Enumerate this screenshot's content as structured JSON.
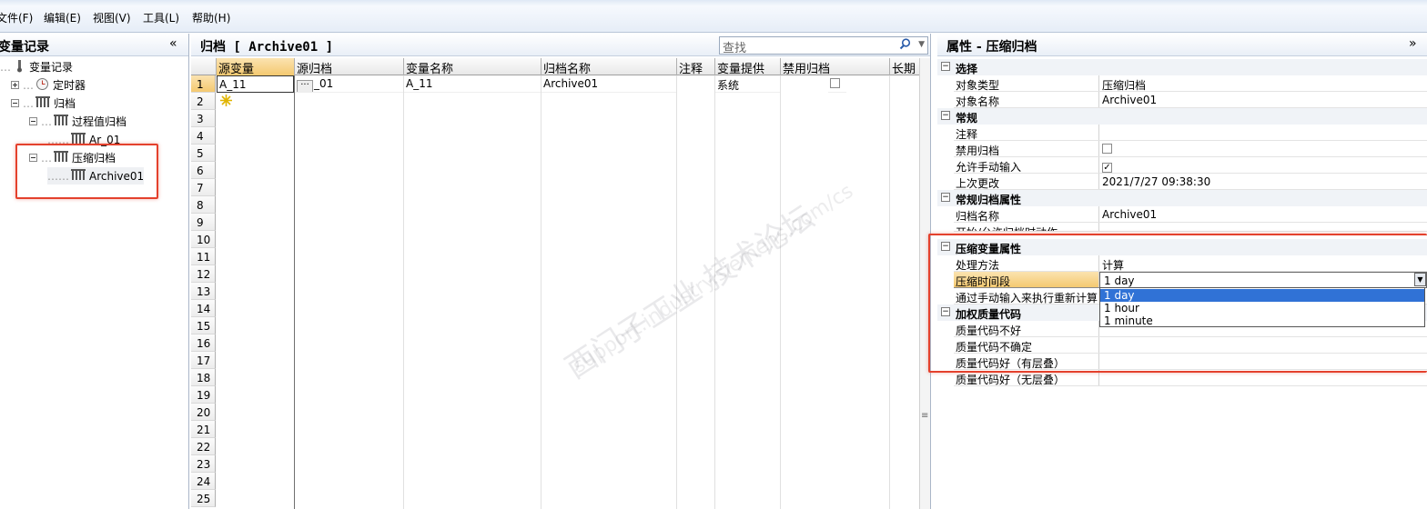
{
  "menu": [
    "文件(F)",
    "编辑(E)",
    "视图(V)",
    "工具(L)",
    "帮助(H)"
  ],
  "left": {
    "title": "变量记录",
    "collapse": "«",
    "tree": [
      {
        "label": "变量记录"
      },
      {
        "label": "定时器"
      },
      {
        "label": "归档"
      },
      {
        "label": "过程值归档"
      },
      {
        "label": "Ar_01"
      },
      {
        "label": "压缩归档"
      },
      {
        "label": "Archive01"
      }
    ]
  },
  "center": {
    "title": "归档 [ Archive01 ]",
    "search_placeholder": "查找",
    "columns": [
      "源变量",
      "源归档",
      "变量名称",
      "归档名称",
      "注释",
      "变量提供",
      "禁用归档",
      "长期"
    ],
    "row1": {
      "num": "1",
      "src_var": "A_11",
      "src_archive": "_01",
      "var_name": "A_11",
      "archive_name": "Archive01",
      "provider": "系统"
    },
    "row_numbers": [
      "2",
      "3",
      "4",
      "5",
      "6",
      "7",
      "8",
      "9",
      "10",
      "11",
      "12",
      "13",
      "14",
      "15",
      "16",
      "17",
      "18",
      "19",
      "20",
      "21",
      "22",
      "23",
      "24",
      "25"
    ]
  },
  "right": {
    "title": "属性 - 压缩归档",
    "expand": "»",
    "sec_select": "选择",
    "obj_type_k": "对象类型",
    "obj_type_v": "压缩归档",
    "obj_name_k": "对象名称",
    "obj_name_v": "Archive01",
    "sec_general": "常规",
    "comment_k": "注释",
    "disable_k": "禁用归档",
    "manual_k": "允许手动输入",
    "last_change_k": "上次更改",
    "last_change_v": "2021/7/27 09:38:30",
    "sec_archive": "常规归档属性",
    "archive_name_k": "归档名称",
    "archive_name_v": "Archive01",
    "start_k": "开始/允许归档时动作",
    "sec_compress": "压缩变量属性",
    "method_k": "处理方法",
    "method_v": "计算",
    "period_k": "压缩时间段",
    "period_v": "1 day",
    "recalc_k": "通过手动输入来执行重新计算",
    "sec_weight": "加权质量代码",
    "q_bad": "质量代码不好",
    "q_uncertain": "质量代码不确定",
    "q_good_overlap": "质量代码好（有层叠）",
    "q_good_nooverlap": "质量代码好（无层叠）",
    "options": [
      "1 day",
      "1 hour",
      "1 minute"
    ]
  },
  "watermark": {
    "line1": "西门子工业 技术论坛",
    "line2": "support.industry.siemens.com/cs"
  },
  "colors": {
    "accent": "#e4412d",
    "selected": "#3072d6",
    "header_highlight": "#f7d592"
  }
}
